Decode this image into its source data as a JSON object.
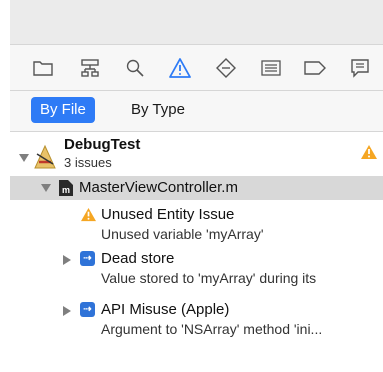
{
  "navigator": {
    "icons": [
      {
        "name": "folder-icon"
      },
      {
        "name": "hierarchy-icon"
      },
      {
        "name": "search-icon"
      },
      {
        "name": "warning-icon",
        "selected": true,
        "color": "#2e7bf6"
      },
      {
        "name": "diamond-icon"
      },
      {
        "name": "list-icon"
      },
      {
        "name": "breakpoint-icon"
      },
      {
        "name": "report-icon"
      }
    ],
    "filter": {
      "by_file": "By File",
      "by_type": "By Type"
    }
  },
  "issues": {
    "project": {
      "name": "DebugTest",
      "count": "3 issues"
    },
    "file": {
      "name": "MasterViewController.m"
    },
    "items": [
      {
        "title": "Unused Entity Issue",
        "detail": "Unused variable 'myArray'",
        "icon": "warning-icon"
      },
      {
        "title": "Dead store",
        "detail": "Value stored to 'myArray' during its",
        "icon": "analyzer-icon"
      },
      {
        "title": "API Misuse (Apple)",
        "detail": "Argument to 'NSArray' method 'ini...",
        "icon": "analyzer-icon"
      }
    ]
  },
  "colors": {
    "accent": "#2e7bf6",
    "warning": "#f5a623",
    "analyzer": "#2f73d8"
  }
}
